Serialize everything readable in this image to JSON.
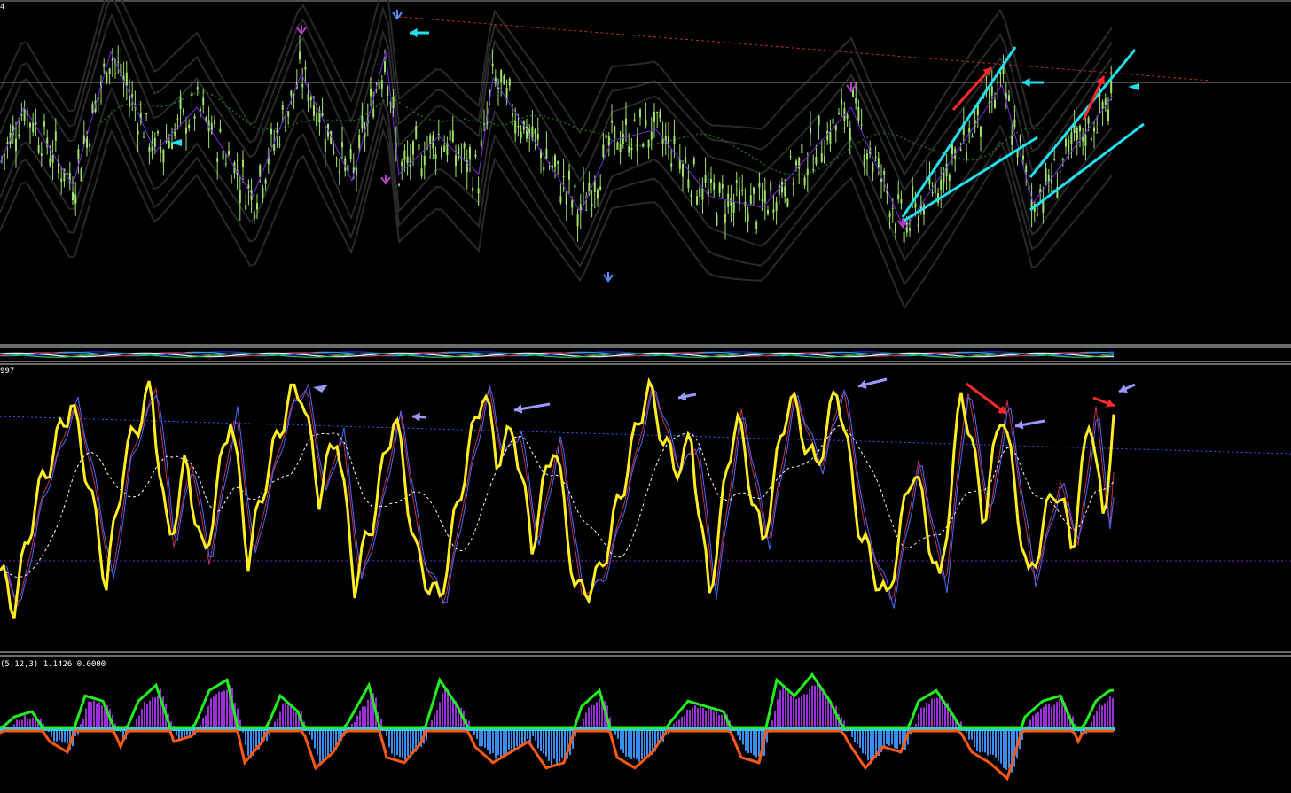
{
  "panels": {
    "main": {
      "corner_label": "4",
      "type": "candlestick"
    },
    "strip": {
      "type": "multiline"
    },
    "oscillator": {
      "corner_label": "997",
      "type": "line"
    },
    "macd": {
      "label": "(5,12,3) 1.1426 0.0000",
      "type": "histogram+line"
    }
  },
  "colors": {
    "background": "#000000",
    "candles": "#9de36b",
    "zigzag": "#7b2ad8",
    "trend_lines": "#22e0ee",
    "red_arrows": "#ff2a2a",
    "resistance": "#c0302a",
    "ma_dotted": "#1a6e1a",
    "envelope": "#2a2a2a",
    "osc_main": "#ffee22",
    "osc_blue": "#4a6cff",
    "osc_red": "#c03050",
    "osc_signal": "#ffffff",
    "osc_level": "#3a5dff",
    "osc_low_level": "#7a2ad8",
    "macd_line_green": "#22ee22",
    "macd_line_orange": "#ff5a14",
    "hist_pos": "#9a30d8",
    "hist_neg": "#3a8ef0",
    "hist_zero": "#33ccdd",
    "marker_arrows": "#9999ff"
  },
  "chart_data": [
    {
      "type": "line",
      "name": "price-zigzag",
      "x": [
        0,
        27,
        82,
        125,
        175,
        222,
        285,
        340,
        397,
        435,
        450,
        495,
        540,
        556,
        655,
        690,
        740,
        800,
        860,
        960,
        1020,
        1130,
        1165,
        1255
      ],
      "values": [
        30,
        55,
        20,
        80,
        35,
        55,
        15,
        70,
        22,
        80,
        25,
        42,
        25,
        68,
        8,
        40,
        45,
        15,
        10,
        55,
        0,
        65,
        12,
        60
      ],
      "ylim": [
        -50,
        100
      ]
    },
    {
      "type": "line",
      "name": "oscillator",
      "x": [
        0,
        15,
        40,
        60,
        80,
        100,
        120,
        140,
        170,
        190,
        210,
        230,
        260,
        280,
        300,
        325,
        340,
        360,
        380,
        400,
        420,
        445,
        470,
        495,
        520,
        545,
        560,
        580,
        600,
        625,
        650,
        675,
        700,
        730,
        760,
        780,
        800,
        830,
        860,
        890,
        920,
        945,
        970,
        1000,
        1030,
        1060,
        1085,
        1110,
        1130,
        1160,
        1190,
        1210,
        1230,
        1245,
        1255
      ],
      "values": [
        25,
        10,
        52,
        72,
        92,
        60,
        20,
        68,
        98,
        35,
        68,
        28,
        88,
        30,
        62,
        92,
        97,
        55,
        80,
        20,
        45,
        88,
        30,
        12,
        58,
        98,
        70,
        80,
        35,
        78,
        15,
        22,
        55,
        98,
        65,
        75,
        15,
        88,
        35,
        95,
        65,
        98,
        40,
        12,
        68,
        18,
        98,
        45,
        92,
        20,
        60,
        35,
        90,
        40,
        88
      ],
      "ylim": [
        0,
        100
      ]
    },
    {
      "type": "bar",
      "name": "macd-histogram",
      "x": [
        0,
        20,
        40,
        60,
        80,
        100,
        120,
        140,
        160,
        180,
        200,
        220,
        240,
        260,
        280,
        300,
        320,
        340,
        360,
        380,
        400,
        420,
        440,
        460,
        480,
        500,
        520,
        540,
        560,
        580,
        600,
        620,
        640,
        660,
        680,
        700,
        720,
        740,
        760,
        780,
        800,
        820,
        840,
        860,
        880,
        900,
        920,
        940,
        960,
        980,
        1000,
        1020,
        1040,
        1060,
        1080,
        1100,
        1120,
        1140,
        1160,
        1180,
        1200,
        1220,
        1240,
        1255
      ],
      "values": [
        -5,
        10,
        15,
        -10,
        -20,
        30,
        25,
        -15,
        25,
        40,
        -10,
        -5,
        35,
        45,
        -30,
        -10,
        30,
        15,
        -35,
        -20,
        10,
        40,
        -25,
        -30,
        -10,
        45,
        20,
        -15,
        -30,
        -20,
        -10,
        -35,
        -30,
        20,
        35,
        -25,
        -35,
        -20,
        5,
        25,
        20,
        15,
        -25,
        -30,
        45,
        30,
        50,
        25,
        -10,
        -35,
        -15,
        -20,
        25,
        35,
        10,
        -20,
        -30,
        -45,
        10,
        25,
        30,
        -10,
        25,
        35
      ],
      "ylim": [
        -60,
        60
      ]
    }
  ]
}
